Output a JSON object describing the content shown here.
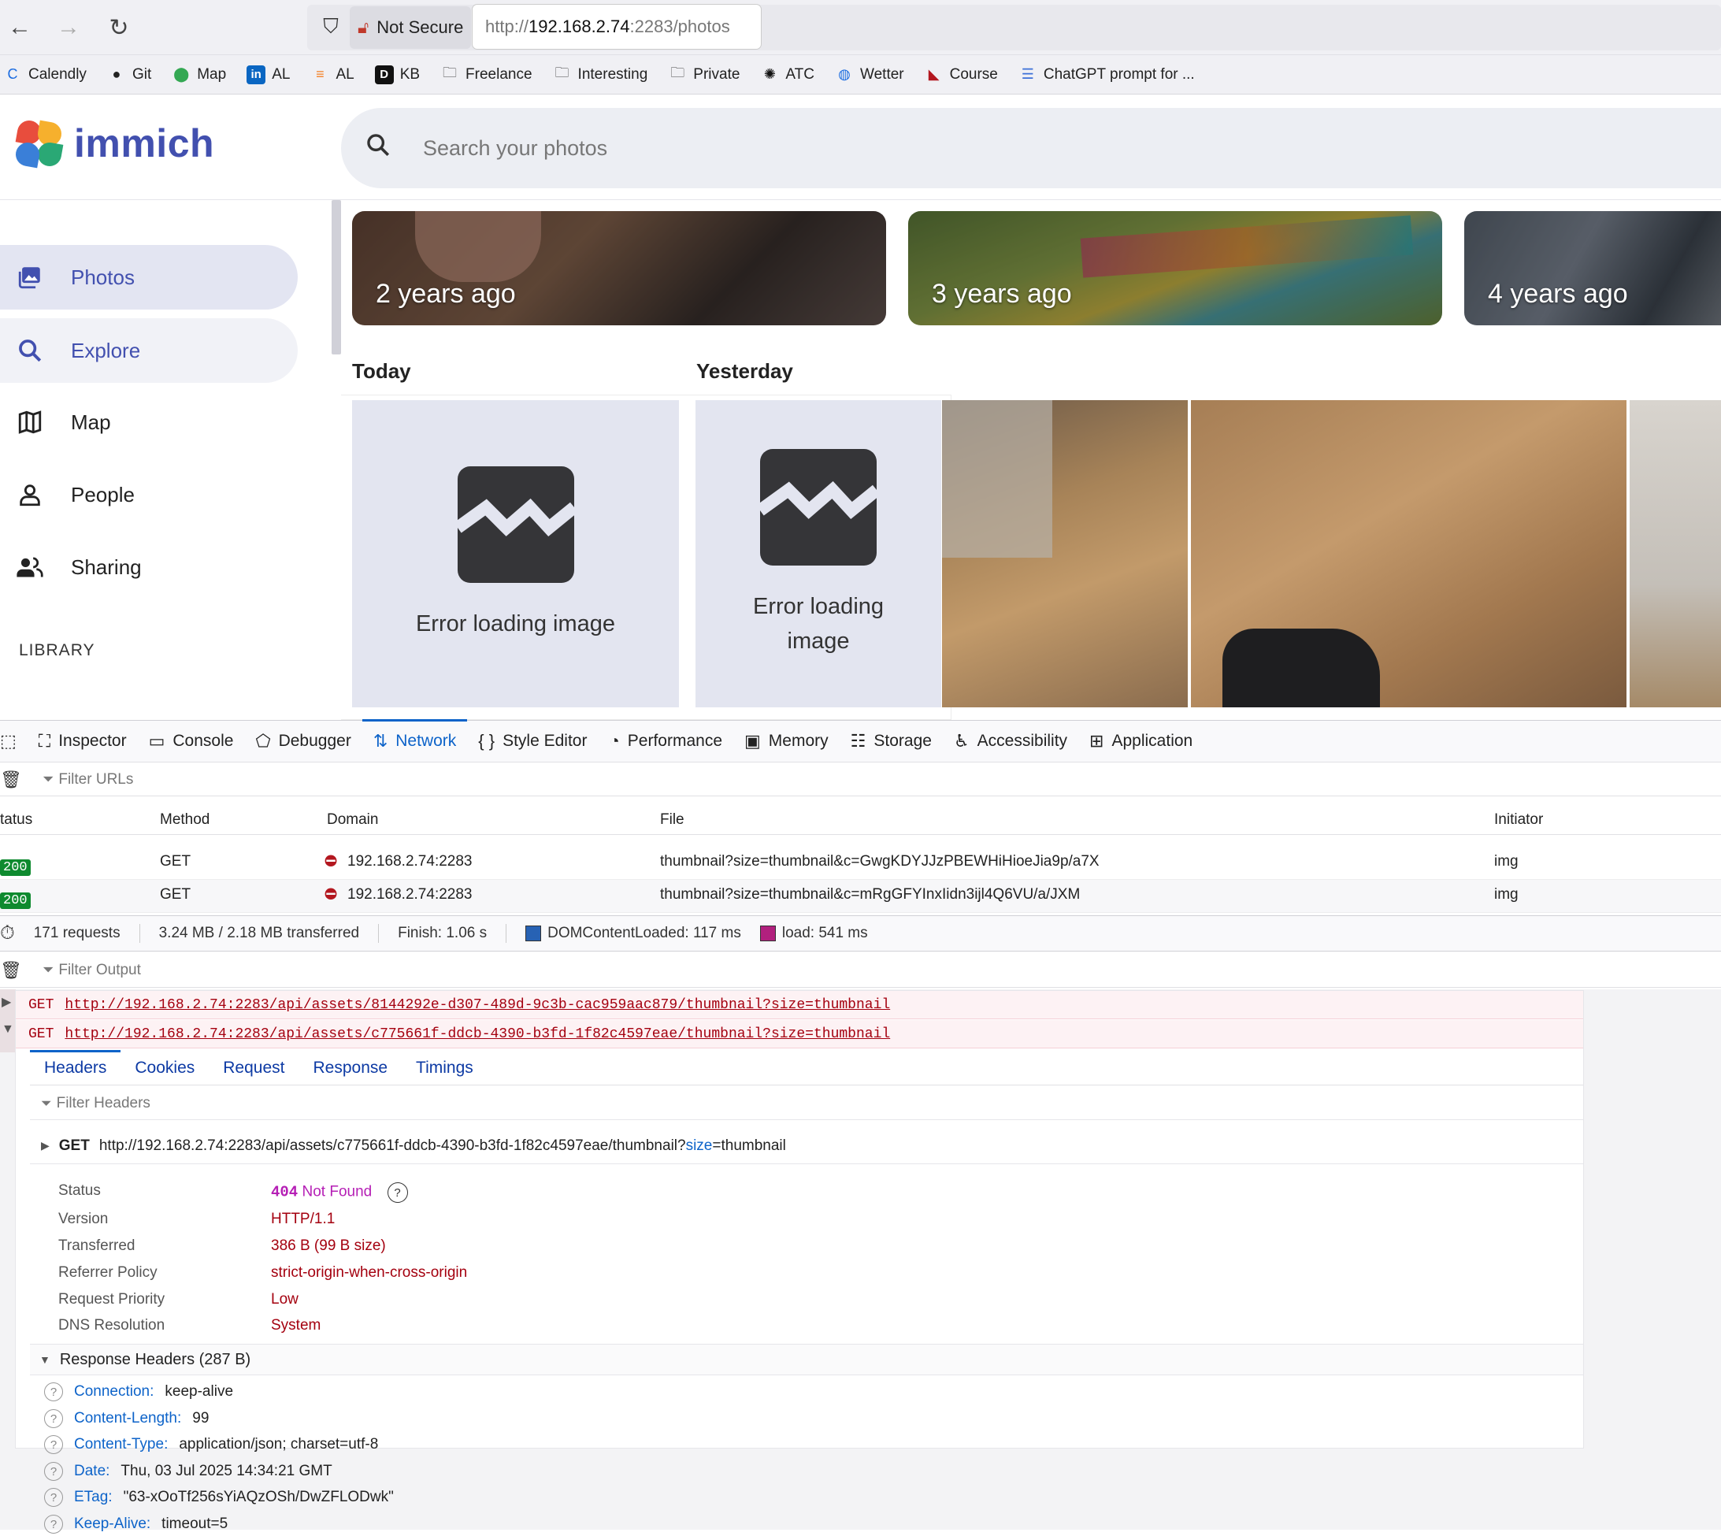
{
  "browser": {
    "not_secure": "Not Secure",
    "url_scheme": "http://",
    "url_host": "192.168.2.74",
    "url_rest": ":2283/photos",
    "bookmarks": [
      {
        "label": "Calendly",
        "icon": "calendly-icon",
        "color": "#1a6be0"
      },
      {
        "label": "Git",
        "icon": "github-icon",
        "color": "#222222"
      },
      {
        "label": "Map",
        "icon": "map-pin-icon",
        "color": "#34a853"
      },
      {
        "label": "AL",
        "icon": "linkedin-icon",
        "color": "#0a66c2"
      },
      {
        "label": "AL",
        "icon": "stackoverflow-icon",
        "color": "#f48024"
      },
      {
        "label": "KB",
        "icon": "d-logo-icon",
        "color": "#111111"
      },
      {
        "label": "Freelance",
        "icon": "folder-icon",
        "color": "#444444"
      },
      {
        "label": "Interesting",
        "icon": "folder-icon",
        "color": "#444444"
      },
      {
        "label": "Private",
        "icon": "folder-icon",
        "color": "#444444"
      },
      {
        "label": "ATC",
        "icon": "openai-icon",
        "color": "#111111"
      },
      {
        "label": "Wetter",
        "icon": "globe-icon",
        "color": "#1a6be0"
      },
      {
        "label": "Course",
        "icon": "course-icon",
        "color": "#b3171f"
      },
      {
        "label": "ChatGPT prompt for ...",
        "icon": "doc-icon",
        "color": "#3b6fd8"
      }
    ]
  },
  "app": {
    "logo_text": "immich",
    "search_placeholder": "Search your photos",
    "brand_color": "#4250af",
    "sidebar": [
      {
        "label": "Photos",
        "icon": "photos-icon"
      },
      {
        "label": "Explore",
        "icon": "search-icon"
      },
      {
        "label": "Map",
        "icon": "map-icon"
      },
      {
        "label": "People",
        "icon": "person-icon"
      },
      {
        "label": "Sharing",
        "icon": "people-icon"
      }
    ],
    "library_title": "LIBRARY",
    "memories": [
      "2 years ago",
      "3 years ago",
      "4 years ago"
    ],
    "date_groups": [
      "Today",
      "Yesterday"
    ],
    "error_text": "Error loading image",
    "error_text_wrapped": [
      "Error loading",
      "image"
    ]
  },
  "devtools": {
    "tabs": [
      {
        "label": "Inspector",
        "icon": "inspector-icon"
      },
      {
        "label": "Console",
        "icon": "console-icon"
      },
      {
        "label": "Debugger",
        "icon": "debugger-icon"
      },
      {
        "label": "Network",
        "icon": "network-icon",
        "active": true
      },
      {
        "label": "Style Editor",
        "icon": "braces-icon"
      },
      {
        "label": "Performance",
        "icon": "gauge-icon"
      },
      {
        "label": "Memory",
        "icon": "chip-icon"
      },
      {
        "label": "Storage",
        "icon": "storage-icon"
      },
      {
        "label": "Accessibility",
        "icon": "accessibility-icon"
      },
      {
        "label": "Application",
        "icon": "grid-icon"
      }
    ],
    "filter_urls": "Filter URLs",
    "columns": [
      "tatus",
      "Method",
      "Domain",
      "File",
      "Initiator"
    ],
    "rows": [
      {
        "status": "200",
        "method": "GET",
        "domain": "192.168.2.74:2283",
        "file": "thumbnail?size=thumbnail&c=GwgKDYJJzPBEWHiHioeJia9p/a7X",
        "initiator": "img"
      },
      {
        "status": "200",
        "method": "GET",
        "domain": "192.168.2.74:2283",
        "file": "thumbnail?size=thumbnail&c=mRgGFYInxIidn3ijl4Q6VU/a/JXM",
        "initiator": "img"
      }
    ],
    "summary": {
      "requests": "171 requests",
      "transferred": "3.24 MB / 2.18 MB transferred",
      "finish": "Finish: 1.06 s",
      "dom_loaded": "DOMContentLoaded: 117 ms",
      "load": "load: 541 ms"
    },
    "filter_output": "Filter Output",
    "console_lines": [
      {
        "method": "GET",
        "url": "http://192.168.2.74:2283/api/assets/8144292e-d307-489d-9c3b-cac959aac879/thumbnail?size=thumbnail"
      },
      {
        "method": "GET",
        "url": "http://192.168.2.74:2283/api/assets/c775661f-ddcb-4390-b3fd-1f82c4597eae/thumbnail?size=thumbnail"
      }
    ],
    "detail_tabs": [
      "Headers",
      "Cookies",
      "Request",
      "Response",
      "Timings"
    ],
    "filter_headers": "Filter Headers",
    "request_line": {
      "method": "GET",
      "url_base": "http://192.168.2.74:2283/api/assets/c775661f-ddcb-4390-b3fd-1f82c4597eae/thumbnail?",
      "param_key": "size",
      "param_val": "=thumbnail"
    },
    "general": [
      {
        "key": "Status",
        "value": "Not Found",
        "code": "404"
      },
      {
        "key": "Version",
        "value": "HTTP/1.1"
      },
      {
        "key": "Transferred",
        "value": "386 B (99 B size)"
      },
      {
        "key": "Referrer Policy",
        "value": "strict-origin-when-cross-origin"
      },
      {
        "key": "Request Priority",
        "value": "Low"
      },
      {
        "key": "DNS Resolution",
        "value": "System"
      }
    ],
    "response_headers_title": "Response Headers (287 B)",
    "response_headers": [
      {
        "name": "Connection:",
        "value": "keep-alive"
      },
      {
        "name": "Content-Length:",
        "value": "99"
      },
      {
        "name": "Content-Type:",
        "value": "application/json; charset=utf-8"
      },
      {
        "name": "Date:",
        "value": "Thu, 03 Jul 2025 14:34:21 GMT"
      },
      {
        "name": "ETag:",
        "value": "\"63-xOoTf256sYiAQzOSh/DwZFLODwk\""
      },
      {
        "name": "Keep-Alive:",
        "value": "timeout=5"
      }
    ]
  }
}
